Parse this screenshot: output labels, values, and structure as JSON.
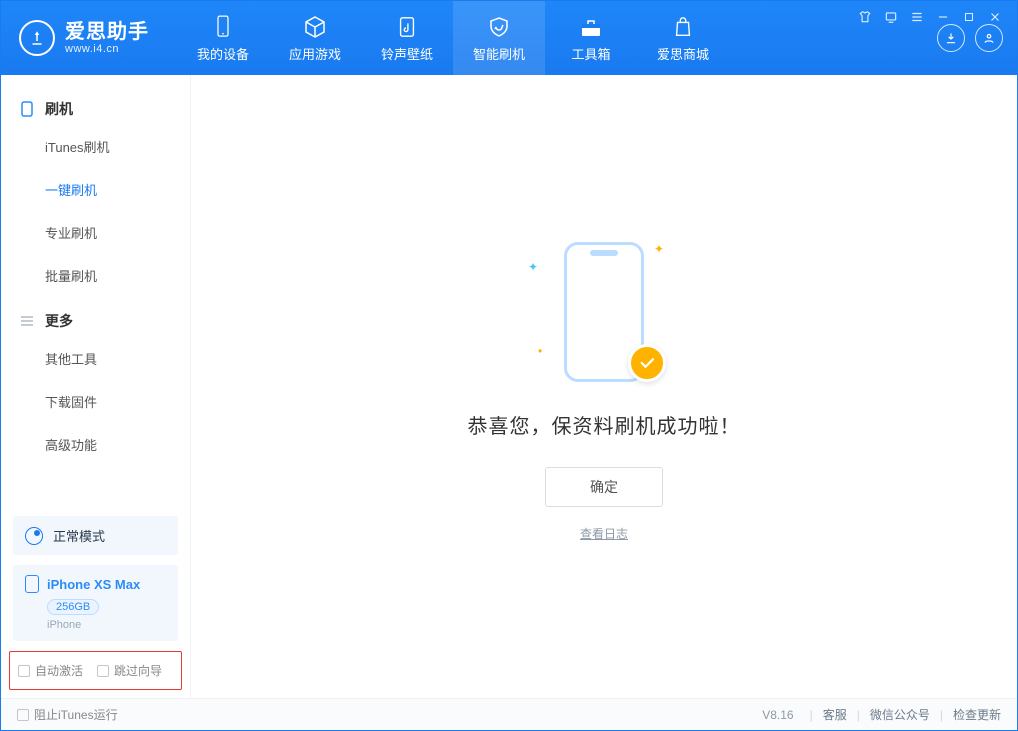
{
  "app": {
    "name": "爱思助手",
    "site": "www.i4.cn"
  },
  "nav": {
    "items": [
      {
        "label": "我的设备"
      },
      {
        "label": "应用游戏"
      },
      {
        "label": "铃声壁纸"
      },
      {
        "label": "智能刷机"
      },
      {
        "label": "工具箱"
      },
      {
        "label": "爱思商城"
      }
    ],
    "active_index": 3
  },
  "sidebar": {
    "groups": [
      {
        "title": "刷机",
        "items": [
          "iTunes刷机",
          "一键刷机",
          "专业刷机",
          "批量刷机"
        ]
      },
      {
        "title": "更多",
        "items": [
          "其他工具",
          "下载固件",
          "高级功能"
        ]
      }
    ],
    "active_item": "一键刷机",
    "mode": {
      "label": "正常模式"
    },
    "device": {
      "name": "iPhone XS Max",
      "storage": "256GB",
      "type": "iPhone"
    },
    "checkbox_row": {
      "auto_activate": "自动激活",
      "skip_wizard": "跳过向导"
    }
  },
  "main": {
    "success_title": "恭喜您，保资料刷机成功啦！",
    "ok_button": "确定",
    "view_log": "查看日志"
  },
  "footer": {
    "block_itunes": "阻止iTunes运行",
    "version": "V8.16",
    "links": [
      "客服",
      "微信公众号",
      "检查更新"
    ]
  }
}
